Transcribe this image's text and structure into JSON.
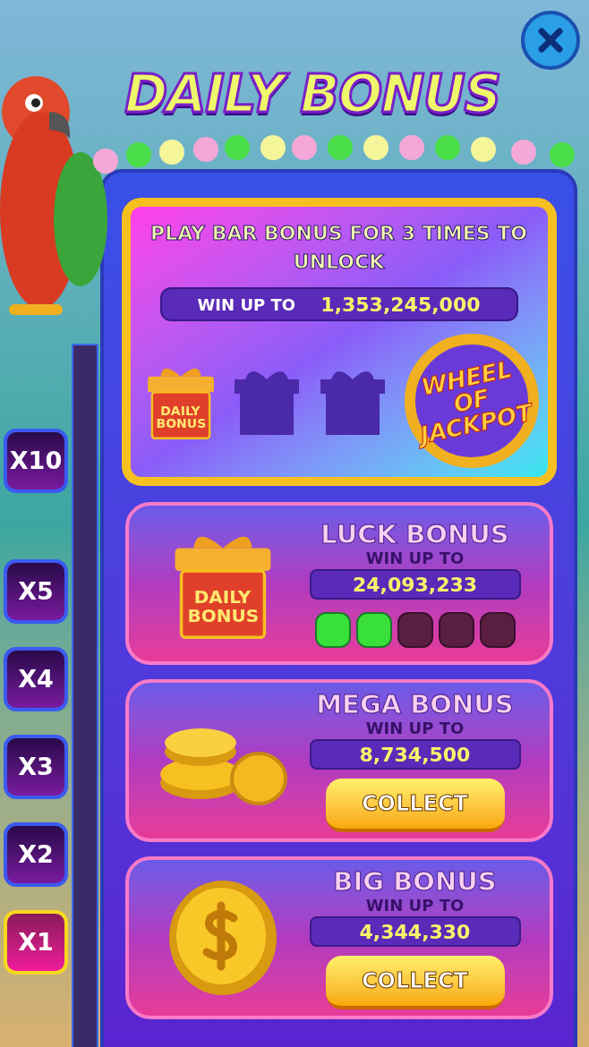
{
  "title": "DAILY BONUS",
  "multipliers": [
    {
      "label": "X10",
      "selected": false
    },
    {
      "label": "X5",
      "selected": false
    },
    {
      "label": "X4",
      "selected": false
    },
    {
      "label": "X3",
      "selected": false
    },
    {
      "label": "X2",
      "selected": false
    },
    {
      "label": "X1",
      "selected": true
    }
  ],
  "unlock_card": {
    "heading": "PLAY BAR BONUS FOR 3 TIMES TO UNLOCK",
    "win_label": "WIN UP TO",
    "win_amount": "1,353,245,000",
    "gifts": [
      {
        "unlocked": true,
        "label": "DAILY BONUS"
      },
      {
        "unlocked": false
      },
      {
        "unlocked": false
      }
    ],
    "wheel_logo": "WHEEL OF JACKPOT"
  },
  "bonuses": [
    {
      "kind": "gift",
      "title": "LUCK BONUS",
      "win_label": "WIN UP TO",
      "amount": "24,093,233",
      "icon_label": "DAILY BONUS",
      "dots": [
        {
          "filled": true
        },
        {
          "filled": true
        },
        {
          "filled": false
        },
        {
          "filled": false
        },
        {
          "filled": false
        }
      ]
    },
    {
      "kind": "coins",
      "title": "MEGA BONUS",
      "win_label": "WIN UP TO",
      "amount": "8,734,500",
      "button": "COLLECT"
    },
    {
      "kind": "coin",
      "title": "BIG BONUS",
      "win_label": "WIN UP TO",
      "amount": "4,344,330",
      "button": "COLLECT"
    }
  ]
}
